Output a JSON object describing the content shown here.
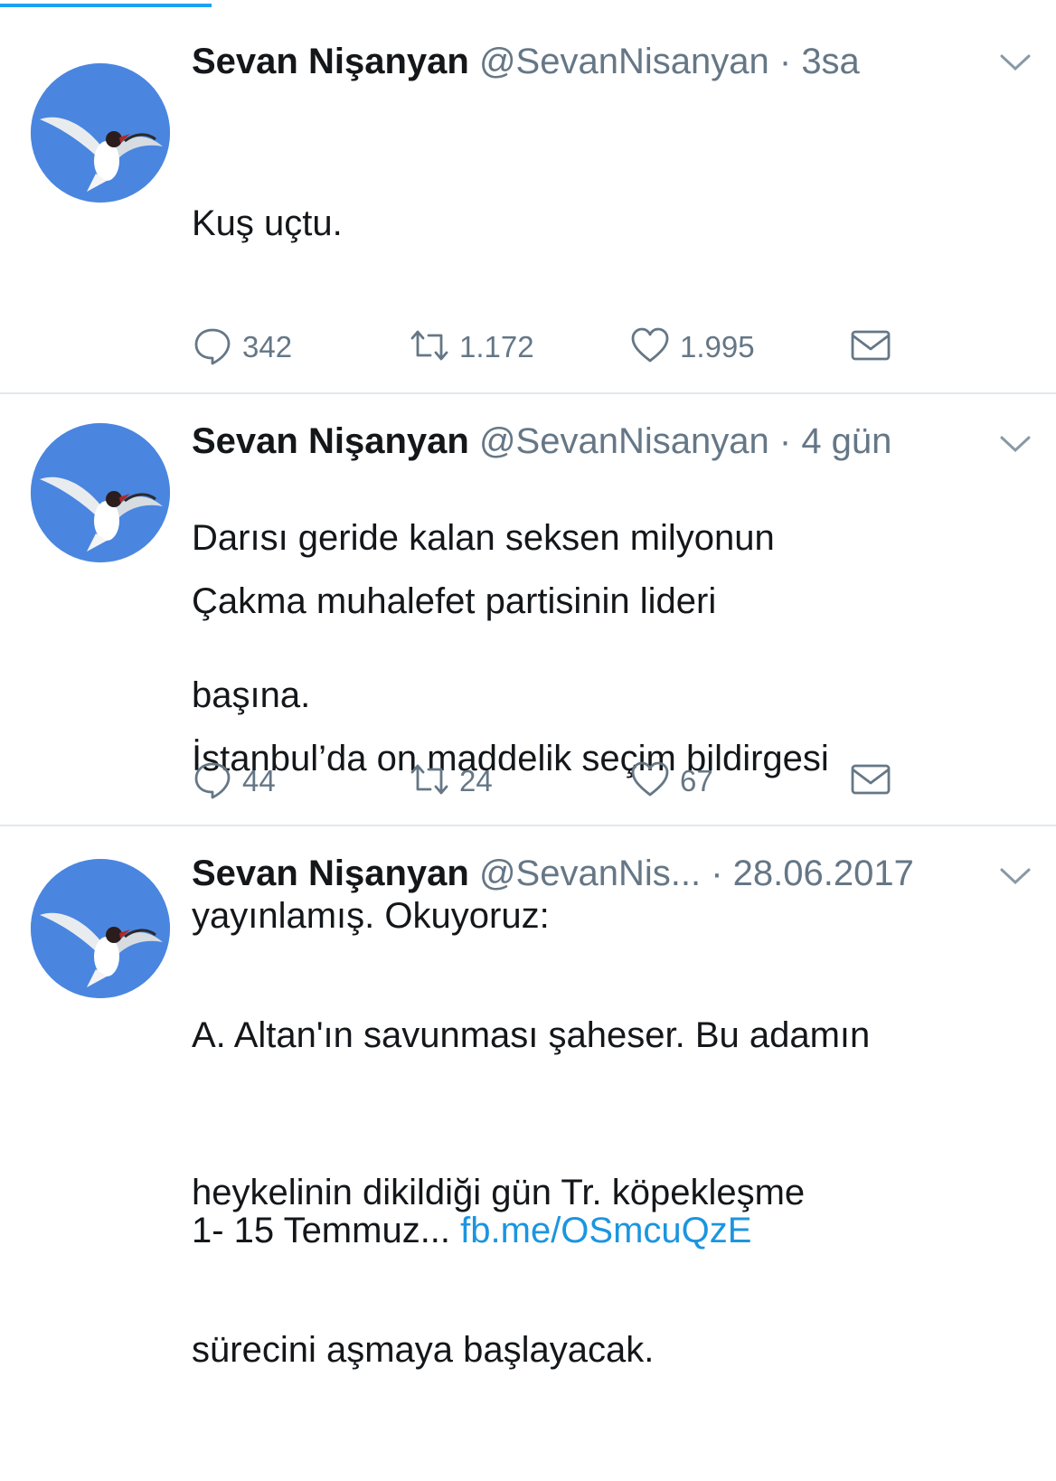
{
  "tweets": [
    {
      "name": "Sevan Nişanyan",
      "handle": "@SevanNisanyan",
      "separator": "·",
      "time": "3sa",
      "lines": [
        "Kuş uçtu.",
        "",
        "Darısı geride kalan seksen milyonun",
        "başına."
      ],
      "link": "",
      "replies": "342",
      "retweets": "1.172",
      "likes": "1.995"
    },
    {
      "name": "Sevan Nişanyan",
      "handle": "@SevanNisanyan",
      "separator": "·",
      "time": "4 gün",
      "lines": [
        "Çakma muhalefet partisinin lideri",
        "İstanbul’da on maddelik seçim bildirgesi",
        "yayınlamış. Okuyoruz:",
        "",
        "1- 15 Temmuz... "
      ],
      "link": "fb.me/OSmcuQzE",
      "replies": "44",
      "retweets": "24",
      "likes": "67"
    },
    {
      "name": "Sevan Nişanyan",
      "handle": "@SevanNis...",
      "separator": "·",
      "time": "28.06.2017",
      "lines": [
        "A. Altan'ın savunması şaheser. Bu adamın",
        "heykelinin dikildiği gün Tr. köpekleşme",
        "sürecini aşmaya başlayacak."
      ],
      "link": ""
    }
  ],
  "icons": {
    "avatar": "seagull-avatar-icon",
    "menu": "chevron-down-icon",
    "reply": "reply-icon",
    "retweet": "retweet-icon",
    "like": "heart-icon",
    "dm": "envelope-icon"
  },
  "colors": {
    "accent": "#1da1f2",
    "link": "#1b95e0",
    "secondary_text": "#657786",
    "separator": "#e1e8ed",
    "avatar_sky": "#4a86e0"
  },
  "progress": {
    "value": 0.2
  }
}
